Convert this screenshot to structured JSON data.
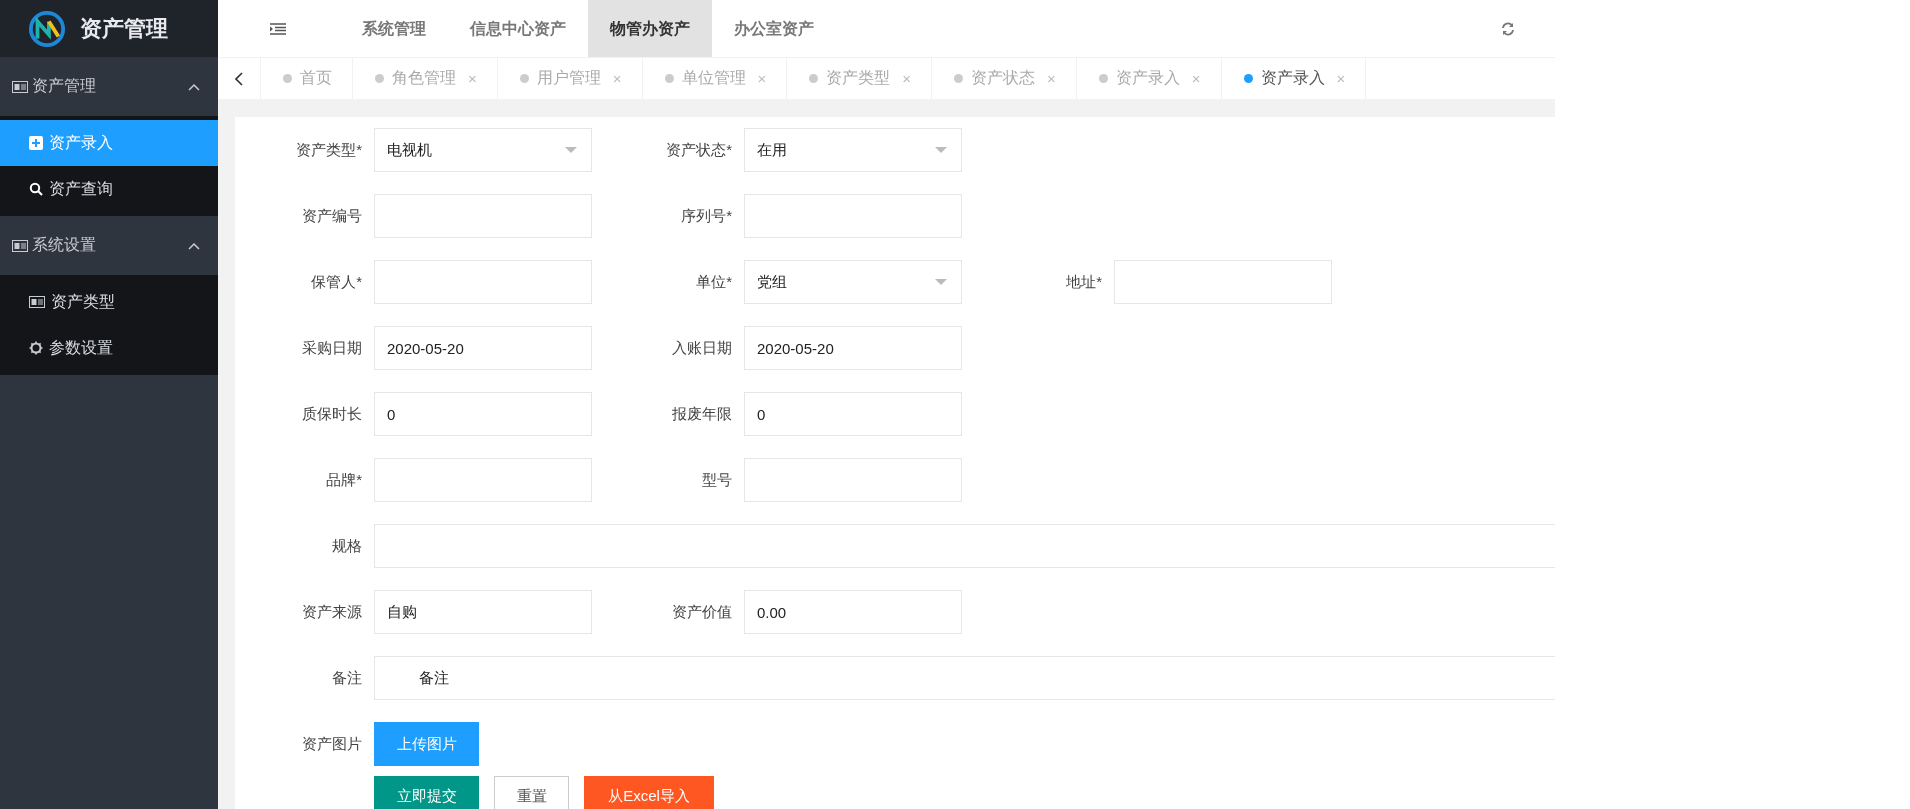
{
  "app": {
    "title": "资产管理"
  },
  "top_nav": [
    {
      "label": "系统管理",
      "selected": false
    },
    {
      "label": "信息中心资产",
      "selected": false
    },
    {
      "label": "物管办资产",
      "selected": true
    },
    {
      "label": "办公室资产",
      "selected": false
    }
  ],
  "sidebar": [
    {
      "label": "资产管理",
      "expanded": true,
      "children": [
        {
          "label": "资产录入",
          "kind": "plus",
          "selected": true
        },
        {
          "label": "资产查询",
          "kind": "search",
          "selected": false
        }
      ]
    },
    {
      "label": "系统设置",
      "expanded": true,
      "children": [
        {
          "label": "资产类型",
          "kind": "card",
          "selected": false
        },
        {
          "label": "参数设置",
          "kind": "gear",
          "selected": false
        }
      ]
    }
  ],
  "tabs": [
    {
      "label": "首页",
      "selected": false
    },
    {
      "label": "角色管理",
      "close": "×",
      "selected": false
    },
    {
      "label": "用户管理",
      "close": "×",
      "selected": false
    },
    {
      "label": "单位管理",
      "close": "×",
      "selected": false
    },
    {
      "label": "资产类型",
      "close": "×",
      "selected": false
    },
    {
      "label": "资产状态",
      "close": "×",
      "selected": false
    },
    {
      "label": "资产录入",
      "close": "×",
      "selected": false
    },
    {
      "label": "资产录入",
      "close": "×",
      "selected": true
    }
  ],
  "form": [
    [
      {
        "label": "资产类型*",
        "kind": "select",
        "value": "电视机"
      },
      {
        "label": "资产状态*",
        "kind": "select",
        "value": "在用"
      }
    ],
    [
      {
        "label": "资产编号",
        "kind": "input"
      },
      {
        "label": "序列号*",
        "kind": "input"
      }
    ],
    [
      {
        "label": "保管人*",
        "kind": "input"
      },
      {
        "label": "单位*",
        "kind": "select",
        "value": "党组"
      },
      {
        "label": "地址*",
        "kind": "input"
      }
    ],
    [
      {
        "label": "采购日期",
        "kind": "input",
        "value": "2020-05-20"
      },
      {
        "label": "入账日期",
        "kind": "input",
        "value": "2020-05-20"
      }
    ],
    [
      {
        "label": "质保时长",
        "kind": "input",
        "value": "0"
      },
      {
        "label": "报废年限",
        "kind": "input",
        "value": "0"
      }
    ],
    [
      {
        "label": "品牌*",
        "kind": "input"
      },
      {
        "label": "型号",
        "kind": "input"
      }
    ],
    [
      {
        "label": "规格",
        "kind": "wide"
      }
    ],
    [
      {
        "label": "资产来源",
        "kind": "input",
        "value": "自购"
      },
      {
        "label": "资产价值",
        "kind": "input",
        "value": "0.00"
      }
    ],
    [
      {
        "label": "备注",
        "kind": "note",
        "value": "备注"
      }
    ],
    [
      {
        "label": "资产图片",
        "kind": "upload",
        "button": "上传图片"
      }
    ]
  ],
  "actions": [
    {
      "label": "立即提交",
      "kind": "primary"
    },
    {
      "label": "重置",
      "kind": "plain"
    },
    {
      "label": "从Excel导入",
      "kind": "warn"
    }
  ]
}
